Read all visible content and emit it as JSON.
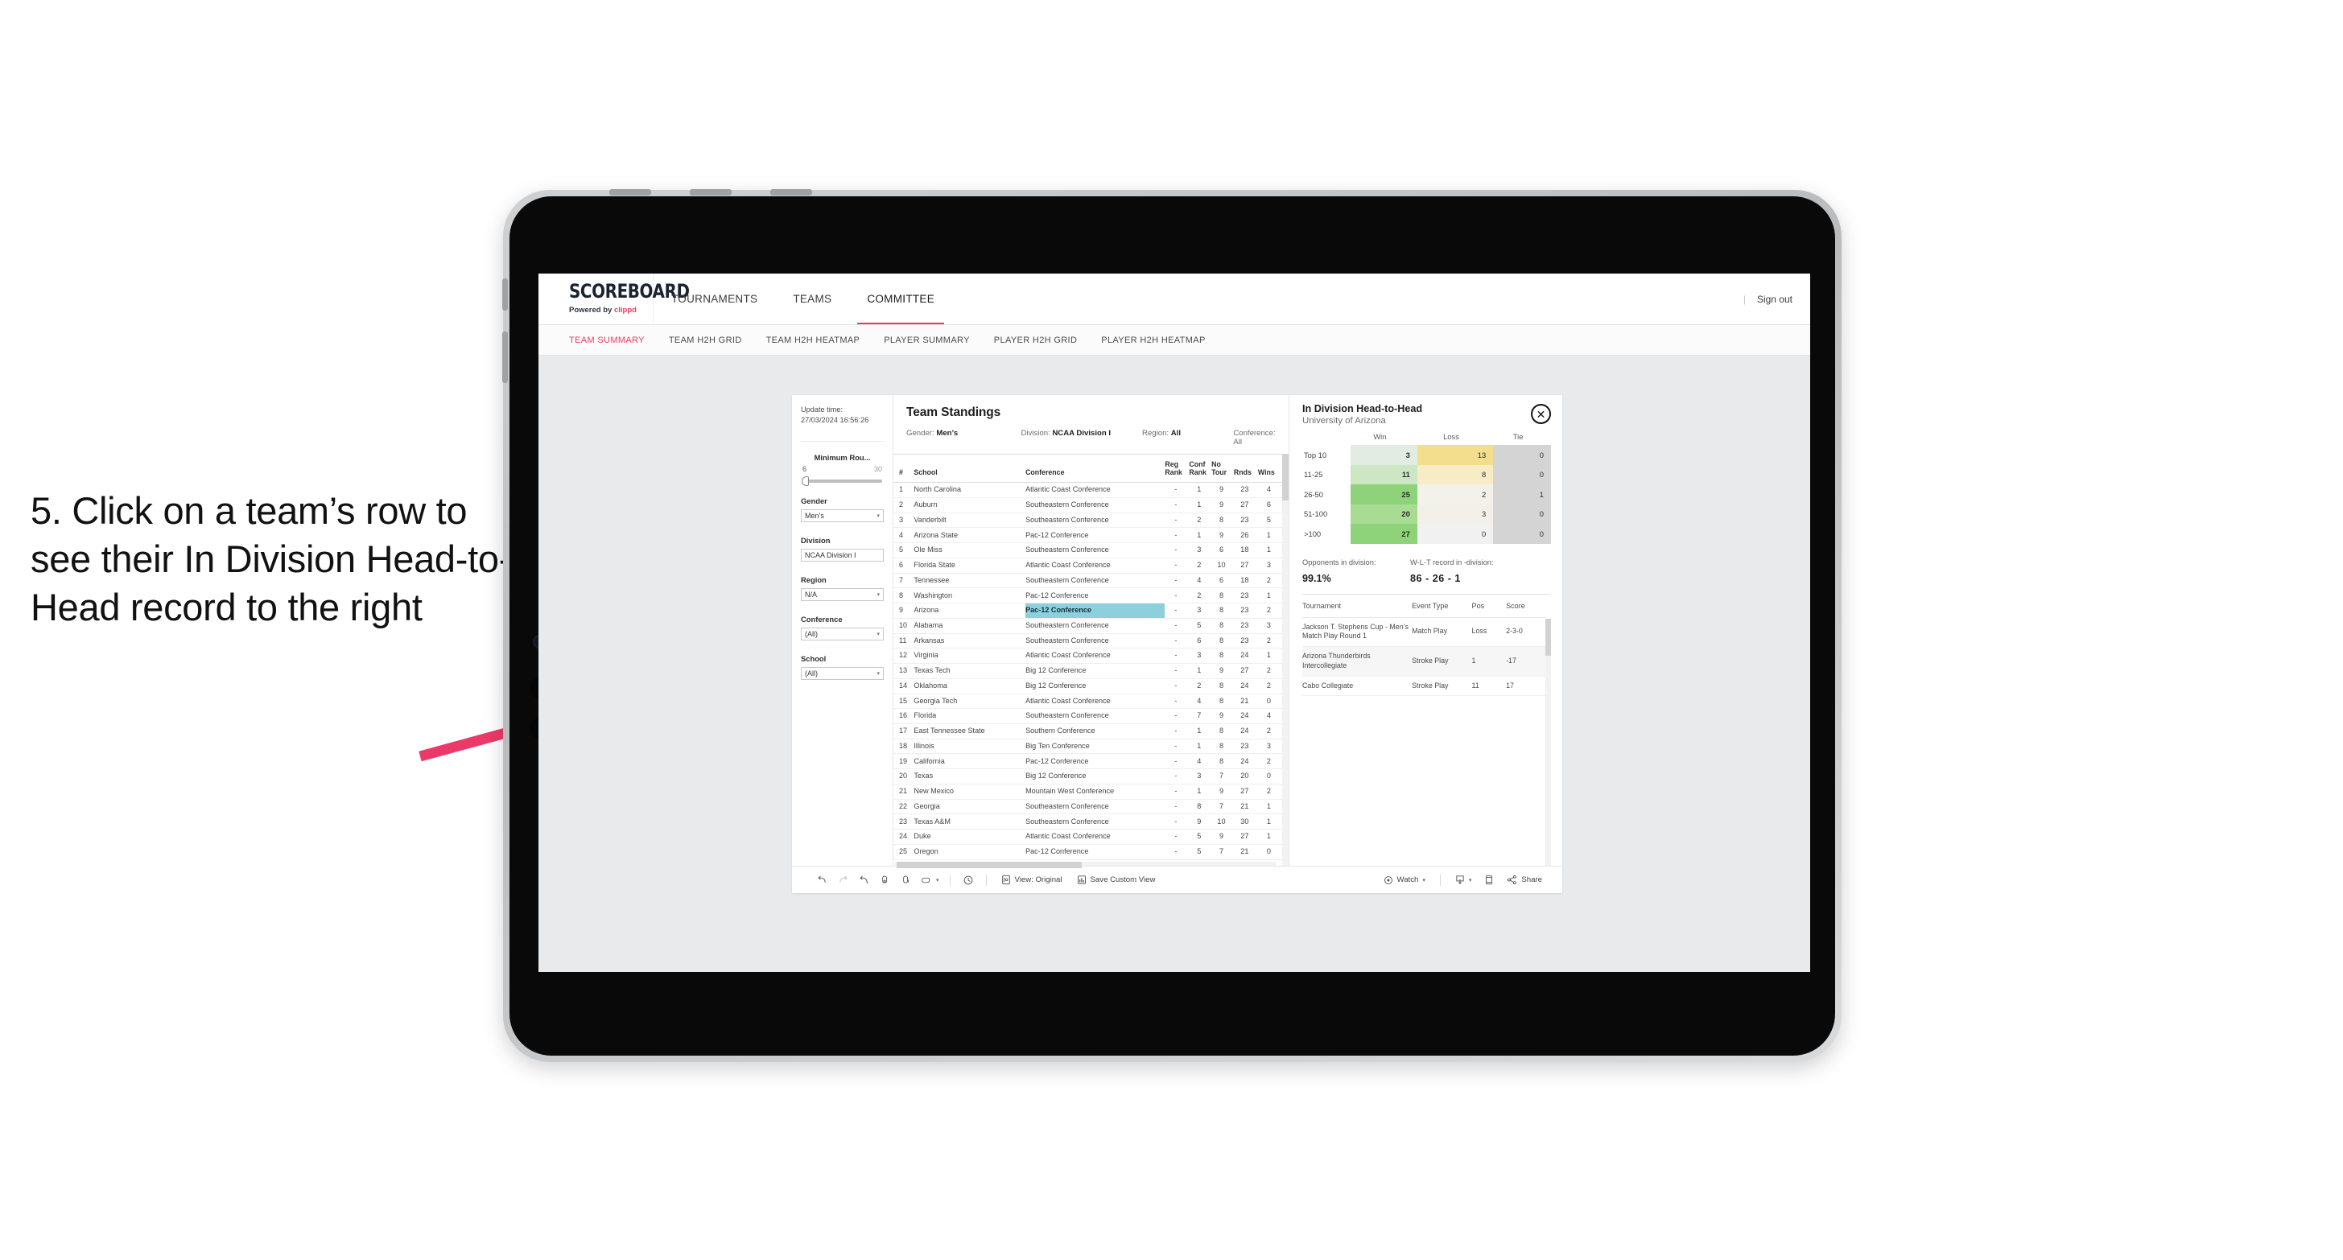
{
  "annotation": {
    "text": "5. Click on a team’s row to see their In Division Head-to-Head record to the right",
    "arrow_color": "#ec3a68"
  },
  "header": {
    "logo_word": "SCOREBOARD",
    "logo_powered_prefix": "Powered by ",
    "logo_brand": "clippd",
    "nav": [
      {
        "label": "TOURNAMENTS",
        "active": false
      },
      {
        "label": "TEAMS",
        "active": false
      },
      {
        "label": "COMMITTEE",
        "active": true
      }
    ],
    "separator": "|",
    "sign_out": "Sign out",
    "accent_color": "#ee3a63"
  },
  "sub_nav": [
    {
      "label": "TEAM SUMMARY",
      "active": true
    },
    {
      "label": "TEAM H2H GRID",
      "active": false
    },
    {
      "label": "TEAM H2H HEATMAP",
      "active": false
    },
    {
      "label": "PLAYER SUMMARY",
      "active": false
    },
    {
      "label": "PLAYER H2H GRID",
      "active": false
    },
    {
      "label": "PLAYER H2H HEATMAP",
      "active": false
    }
  ],
  "filters": {
    "update_time_label": "Update time:",
    "update_time_value": "27/03/2024 16:56:26",
    "slider": {
      "title": "Minimum Rou...",
      "min": "6",
      "max": "30"
    },
    "groups": [
      {
        "label": "Gender",
        "value": "Men’s",
        "caret": "▾"
      },
      {
        "label": "Division",
        "value": "NCAA Division I",
        "caret": ""
      },
      {
        "label": "Region",
        "value": "N/A",
        "caret": "▾"
      },
      {
        "label": "Conference",
        "value": "(All)",
        "caret": "▾"
      },
      {
        "label": "School",
        "value": "(All)",
        "caret": "▾"
      }
    ]
  },
  "standings": {
    "title": "Team Standings",
    "meta": [
      {
        "label": "Gender: ",
        "value": "Men’s"
      },
      {
        "label": "Division: ",
        "value": "NCAA Division I"
      },
      {
        "label": "Region: ",
        "value": "All"
      },
      {
        "label": "Conference: ",
        "value": "All"
      }
    ],
    "columns": [
      "#",
      "School",
      "Conference",
      "Reg Rank",
      "Conf Rank",
      "No Tour",
      "Rnds",
      "Wins"
    ],
    "columns_wrapped": [
      {
        "l1": "#",
        "l2": ""
      },
      {
        "l1": "School",
        "l2": ""
      },
      {
        "l1": "Conference",
        "l2": ""
      },
      {
        "l1": "Reg",
        "l2": "Rank"
      },
      {
        "l1": "Conf",
        "l2": "Rank"
      },
      {
        "l1": "No",
        "l2": "Tour"
      },
      {
        "l1": "Rnds",
        "l2": ""
      },
      {
        "l1": "Wins",
        "l2": ""
      }
    ],
    "selected_row": 9,
    "selected_highlight_color": "#8ccfdd",
    "rows": [
      {
        "rank": "1",
        "school": "North Carolina",
        "conference": "Atlantic Coast Conference",
        "reg_rank": "-",
        "conf_rank": "1",
        "no_tour": "9",
        "rnds": "23",
        "wins": "4"
      },
      {
        "rank": "2",
        "school": "Auburn",
        "conference": "Southeastern Conference",
        "reg_rank": "-",
        "conf_rank": "1",
        "no_tour": "9",
        "rnds": "27",
        "wins": "6"
      },
      {
        "rank": "3",
        "school": "Vanderbilt",
        "conference": "Southeastern Conference",
        "reg_rank": "-",
        "conf_rank": "2",
        "no_tour": "8",
        "rnds": "23",
        "wins": "5"
      },
      {
        "rank": "4",
        "school": "Arizona State",
        "conference": "Pac-12 Conference",
        "reg_rank": "-",
        "conf_rank": "1",
        "no_tour": "9",
        "rnds": "26",
        "wins": "1"
      },
      {
        "rank": "5",
        "school": "Ole Miss",
        "conference": "Southeastern Conference",
        "reg_rank": "-",
        "conf_rank": "3",
        "no_tour": "6",
        "rnds": "18",
        "wins": "1"
      },
      {
        "rank": "6",
        "school": "Florida State",
        "conference": "Atlantic Coast Conference",
        "reg_rank": "-",
        "conf_rank": "2",
        "no_tour": "10",
        "rnds": "27",
        "wins": "3"
      },
      {
        "rank": "7",
        "school": "Tennessee",
        "conference": "Southeastern Conference",
        "reg_rank": "-",
        "conf_rank": "4",
        "no_tour": "6",
        "rnds": "18",
        "wins": "2"
      },
      {
        "rank": "8",
        "school": "Washington",
        "conference": "Pac-12 Conference",
        "reg_rank": "-",
        "conf_rank": "2",
        "no_tour": "8",
        "rnds": "23",
        "wins": "1"
      },
      {
        "rank": "9",
        "school": "Arizona",
        "conference": "Pac-12 Conference",
        "reg_rank": "-",
        "conf_rank": "3",
        "no_tour": "8",
        "rnds": "23",
        "wins": "2"
      },
      {
        "rank": "10",
        "school": "Alabama",
        "conference": "Southeastern Conference",
        "reg_rank": "-",
        "conf_rank": "5",
        "no_tour": "8",
        "rnds": "23",
        "wins": "3"
      },
      {
        "rank": "11",
        "school": "Arkansas",
        "conference": "Southeastern Conference",
        "reg_rank": "-",
        "conf_rank": "6",
        "no_tour": "8",
        "rnds": "23",
        "wins": "2"
      },
      {
        "rank": "12",
        "school": "Virginia",
        "conference": "Atlantic Coast Conference",
        "reg_rank": "-",
        "conf_rank": "3",
        "no_tour": "8",
        "rnds": "24",
        "wins": "1"
      },
      {
        "rank": "13",
        "school": "Texas Tech",
        "conference": "Big 12 Conference",
        "reg_rank": "-",
        "conf_rank": "1",
        "no_tour": "9",
        "rnds": "27",
        "wins": "2"
      },
      {
        "rank": "14",
        "school": "Oklahoma",
        "conference": "Big 12 Conference",
        "reg_rank": "-",
        "conf_rank": "2",
        "no_tour": "8",
        "rnds": "24",
        "wins": "2"
      },
      {
        "rank": "15",
        "school": "Georgia Tech",
        "conference": "Atlantic Coast Conference",
        "reg_rank": "-",
        "conf_rank": "4",
        "no_tour": "8",
        "rnds": "21",
        "wins": "0"
      },
      {
        "rank": "16",
        "school": "Florida",
        "conference": "Southeastern Conference",
        "reg_rank": "-",
        "conf_rank": "7",
        "no_tour": "9",
        "rnds": "24",
        "wins": "4"
      },
      {
        "rank": "17",
        "school": "East Tennessee State",
        "conference": "Southern Conference",
        "reg_rank": "-",
        "conf_rank": "1",
        "no_tour": "8",
        "rnds": "24",
        "wins": "2"
      },
      {
        "rank": "18",
        "school": "Illinois",
        "conference": "Big Ten Conference",
        "reg_rank": "-",
        "conf_rank": "1",
        "no_tour": "8",
        "rnds": "23",
        "wins": "3"
      },
      {
        "rank": "19",
        "school": "California",
        "conference": "Pac-12 Conference",
        "reg_rank": "-",
        "conf_rank": "4",
        "no_tour": "8",
        "rnds": "24",
        "wins": "2"
      },
      {
        "rank": "20",
        "school": "Texas",
        "conference": "Big 12 Conference",
        "reg_rank": "-",
        "conf_rank": "3",
        "no_tour": "7",
        "rnds": "20",
        "wins": "0"
      },
      {
        "rank": "21",
        "school": "New Mexico",
        "conference": "Mountain West Conference",
        "reg_rank": "-",
        "conf_rank": "1",
        "no_tour": "9",
        "rnds": "27",
        "wins": "2"
      },
      {
        "rank": "22",
        "school": "Georgia",
        "conference": "Southeastern Conference",
        "reg_rank": "-",
        "conf_rank": "8",
        "no_tour": "7",
        "rnds": "21",
        "wins": "1"
      },
      {
        "rank": "23",
        "school": "Texas A&M",
        "conference": "Southeastern Conference",
        "reg_rank": "-",
        "conf_rank": "9",
        "no_tour": "10",
        "rnds": "30",
        "wins": "1"
      },
      {
        "rank": "24",
        "school": "Duke",
        "conference": "Atlantic Coast Conference",
        "reg_rank": "-",
        "conf_rank": "5",
        "no_tour": "9",
        "rnds": "27",
        "wins": "1"
      },
      {
        "rank": "25",
        "school": "Oregon",
        "conference": "Pac-12 Conference",
        "reg_rank": "-",
        "conf_rank": "5",
        "no_tour": "7",
        "rnds": "21",
        "wins": "0"
      }
    ]
  },
  "h2h": {
    "title": "In Division Head-to-Head",
    "subtitle": "University of Arizona",
    "close_icon": "✕",
    "chart_data": {
      "type": "heatmap",
      "title": "In Division Head-to-Head",
      "subtitle": "University of Arizona",
      "columns": [
        "Win",
        "Loss",
        "Tie"
      ],
      "rows": [
        "Top 10",
        "11-25",
        "26-50",
        "51-100",
        ">100"
      ],
      "values": [
        [
          3,
          13,
          0
        ],
        [
          11,
          8,
          0
        ],
        [
          25,
          2,
          1
        ],
        [
          20,
          3,
          0
        ],
        [
          27,
          0,
          0
        ]
      ],
      "cell_colors": [
        [
          "#e2ece2",
          "#f2de8d",
          "#d4d4d4"
        ],
        [
          "#cde6c3",
          "#f7ecc5",
          "#d4d4d4"
        ],
        [
          "#8ed37a",
          "#f2f1ea",
          "#d4d4d4"
        ],
        [
          "#a8dc92",
          "#f3f0e9",
          "#d4d4d4"
        ],
        [
          "#8ed37a",
          "#f1f1f1",
          "#d4d4d4"
        ]
      ],
      "win_color_scale": "green",
      "loss_color_scale": "yellow",
      "tie_color": "#d4d4d4"
    },
    "summary": [
      {
        "label": "Opponents in division:",
        "value": "99.1%"
      },
      {
        "label": "W-L-T record in -division:",
        "value": "86 - 26 - 1"
      }
    ],
    "tournament_columns": [
      "Tournament",
      "Event Type",
      "Pos",
      "Score"
    ],
    "tournaments": [
      {
        "name": "Jackson T. Stephens Cup - Men’s Match Play Round 1",
        "event_type": "Match Play",
        "pos": "Loss",
        "score": "2-3-0"
      },
      {
        "name": "Arizona Thunderbirds Intercollegiate",
        "event_type": "Stroke Play",
        "pos": "1",
        "score": "-17"
      },
      {
        "name": "Cabo Collegiate",
        "event_type": "Stroke Play",
        "pos": "11",
        "score": "17"
      }
    ]
  },
  "toolbar": {
    "view_label": "View: Original",
    "save_label": "Save Custom View",
    "watch_label": "Watch",
    "share_label": "Share",
    "caret": "▾"
  }
}
